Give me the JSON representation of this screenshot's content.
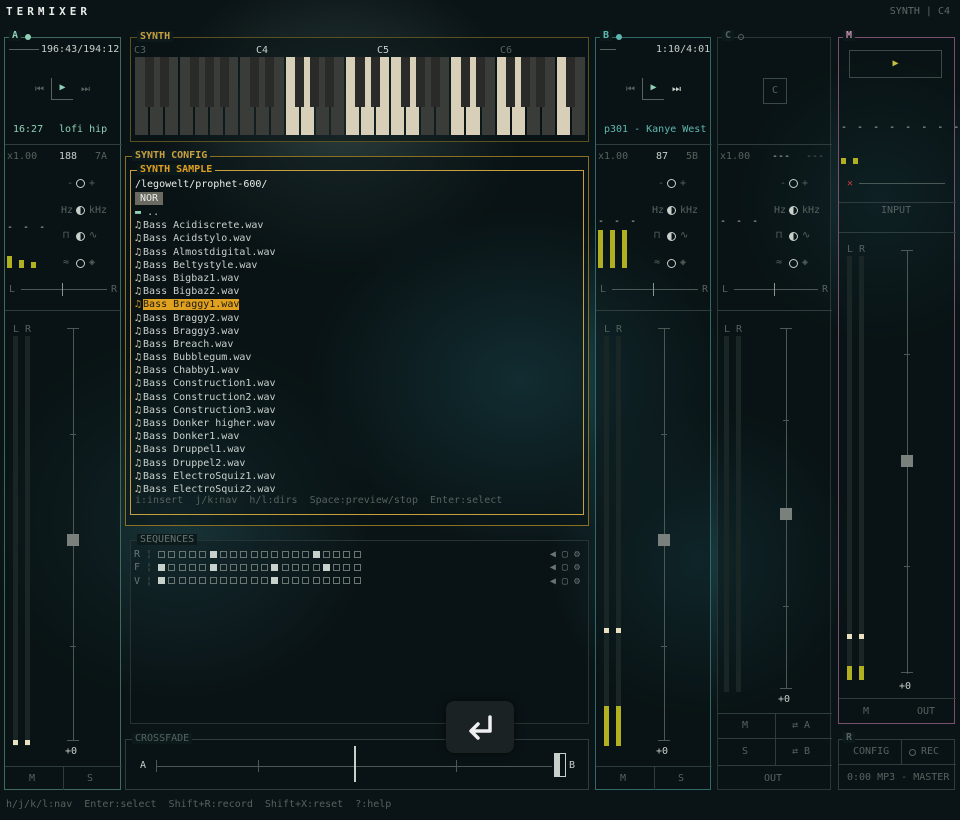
{
  "app": {
    "title": "TERMIXER",
    "status": "SYNTH | C4"
  },
  "deckA": {
    "label": "A",
    "time": "196:43/194:12",
    "elapsed": "16:27",
    "track": "lofi hip",
    "speed": "x1.00",
    "bpm": "188",
    "key": "7A",
    "minus": "-",
    "plus": "+",
    "hz": "Hz",
    "khz": "kHz",
    "pan_l": "L",
    "pan_r": "R",
    "meter_l": "L",
    "meter_r": "R",
    "gain": "+0",
    "mute": "M",
    "solo": "S"
  },
  "synth": {
    "label": "SYNTH",
    "octaves": [
      "C3",
      "C4",
      "C5",
      "C6"
    ]
  },
  "synth_config": {
    "label": "SYNTH CONFIG",
    "sample_label": "SYNTH SAMPLE",
    "path": "/legowelt/prophet-600/",
    "mode": "NOR",
    "parent": "..",
    "files": [
      "Bass Acidiscrete.wav",
      "Bass Acidstylo.wav",
      "Bass Almostdigital.wav",
      "Bass Beltystyle.wav",
      "Bass Bigbaz1.wav",
      "Bass Bigbaz2.wav",
      "Bass Braggy1.wav",
      "Bass Braggy2.wav",
      "Bass Braggy3.wav",
      "Bass Breach.wav",
      "Bass Bubblegum.wav",
      "Bass Chabby1.wav",
      "Bass Construction1.wav",
      "Bass Construction2.wav",
      "Bass Construction3.wav",
      "Bass Donker higher.wav",
      "Bass Donker1.wav",
      "Bass Druppel1.wav",
      "Bass Druppel2.wav",
      "Bass ElectroSquiz1.wav",
      "Bass ElectroSquiz2.wav"
    ],
    "selected_index": 6,
    "hints": "i:insert  j/k:nav  h/l:dirs  Space:preview/stop  Enter:select"
  },
  "sequences": {
    "label": "SEQUENCES",
    "rows": [
      {
        "name": "R",
        "steps": [
          0,
          0,
          0,
          0,
          0,
          1,
          0,
          0,
          0,
          0,
          0,
          0,
          0,
          0,
          0,
          1,
          0,
          0,
          0,
          0
        ]
      },
      {
        "name": "F",
        "steps": [
          1,
          0,
          0,
          0,
          0,
          1,
          0,
          0,
          0,
          0,
          0,
          1,
          0,
          0,
          0,
          0,
          1,
          0,
          0,
          0
        ]
      },
      {
        "name": "V",
        "steps": [
          1,
          0,
          0,
          0,
          0,
          0,
          0,
          0,
          0,
          0,
          0,
          1,
          0,
          0,
          0,
          0,
          0,
          0,
          0,
          0
        ]
      }
    ]
  },
  "crossfade": {
    "label": "CROSSFADE",
    "a": "A",
    "b": "B",
    "position": 0.5
  },
  "deckB": {
    "label": "B",
    "time": "1:10/4:01",
    "track": "p301 - Kanye West",
    "speed": "x1.00",
    "bpm": "87",
    "key": "5B",
    "minus": "-",
    "plus": "+",
    "hz": "Hz",
    "khz": "kHz",
    "pan_l": "L",
    "pan_r": "R",
    "meter_l": "L",
    "meter_r": "R",
    "gain": "+0",
    "mute": "M",
    "solo": "S"
  },
  "deckC": {
    "label": "C",
    "button": "C",
    "speed": "x1.00",
    "bpm": "---",
    "key": "---",
    "minus": "-",
    "plus": "+",
    "hz": "Hz",
    "khz": "kHz",
    "pan_l": "L",
    "pan_r": "R",
    "meter_l": "L",
    "meter_r": "R",
    "gain": "+0",
    "mute": "M",
    "to_a": "⇄ A",
    "solo": "S",
    "to_b": "⇄ B",
    "out": "OUT"
  },
  "master": {
    "label": "M",
    "input": "INPUT",
    "meter_l": "L",
    "meter_r": "R",
    "gain": "+0",
    "mute": "M",
    "out": "OUT"
  },
  "recorder": {
    "label": "R",
    "config": "CONFIG",
    "rec": "REC",
    "status": "0:00 MP3 - MASTER"
  },
  "footer": {
    "hints": "h/j/k/l:nav  Enter:select  Shift+R:record  Shift+X:reset  ?:help"
  },
  "colors": {
    "accent_a": "#8fd0b8",
    "accent_synth": "#c8a040",
    "accent_b": "#5fb8b0",
    "accent_m": "#c890b0",
    "selected": "#e0a020",
    "meter": "#b0b020"
  }
}
